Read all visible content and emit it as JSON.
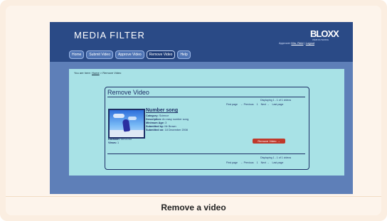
{
  "app": {
    "title": "MEDIA FILTER",
    "logo": "BLOXX",
    "logo_sub": "WEB FILTERING",
    "user_prefix": "Approver",
    "user_link": "Mrs. Reid",
    "separator": "|",
    "logout": "Logout"
  },
  "nav": {
    "items": [
      {
        "label": "Home"
      },
      {
        "label": "Submit Video"
      },
      {
        "label": "Approve Video"
      },
      {
        "label": "Remove Video"
      },
      {
        "label": "Help"
      }
    ]
  },
  "breadcrumb": {
    "prefix": "You are here:",
    "home": "Home",
    "current": "> Remove Video"
  },
  "panel": {
    "title": "Remove Video",
    "displaying": "Displaying 1 - 1 of 1 videos",
    "pager": {
      "first": "First page",
      "prev": "← Previous",
      "page": "1",
      "next": "Next →",
      "last": "Last page"
    }
  },
  "video": {
    "title": "Number song",
    "category_label": "Category:",
    "category": "Science",
    "description_label": "Description:",
    "description": "An easy number song",
    "minimum_age_label": "Minimum Age:",
    "minimum_age": "3",
    "submitted_by_label": "Submitted by:",
    "submitted_by": "Mr Brown",
    "submitted_on_label": "Submitted on:",
    "submitted_on": "18 December 2008",
    "duration_label": "Duration:",
    "duration": "00:01:53",
    "views_label": "Views:",
    "views": "1",
    "remove_label": "Remove Video →"
  },
  "caption": "Remove a video"
}
